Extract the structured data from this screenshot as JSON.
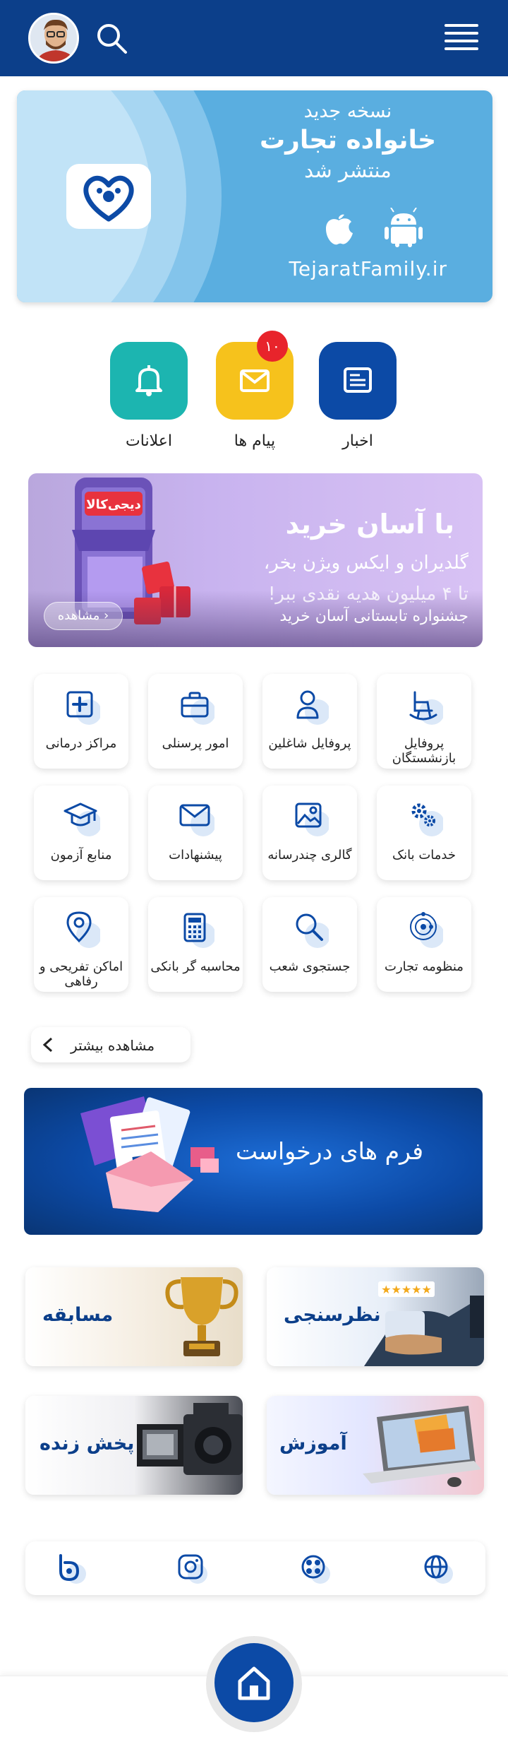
{
  "header": {
    "avatar_alt": "avatar",
    "search_icon": "search-icon",
    "menu_icon": "hamburger-menu-icon",
    "color": "#0c3f8a"
  },
  "promo": {
    "line1": "نسخه جدید",
    "line2": "خانواده تجارت",
    "line3": "منتشر شد",
    "url": "TejaratFamily.ir",
    "platforms": [
      "apple-icon",
      "android-icon"
    ],
    "color": "#5aaee0"
  },
  "quick_access": [
    {
      "label": "اخبار",
      "icon": "news-icon",
      "color": "#0c4aa6"
    },
    {
      "label": "پیام ها",
      "icon": "mail-icon",
      "color": "#f6c21c",
      "badge": "۱۰"
    },
    {
      "label": "اعلانات",
      "icon": "bell-icon",
      "color": "#1cb5b0"
    }
  ],
  "ad": {
    "title": "با آسان خرید",
    "subtitle1": "گلدیران و ایکس ویژن بخر،",
    "subtitle2": "تا ۴ میلیون هدیه نقدی ببر!",
    "caption": "جشنواره تابستانی آسان خرید",
    "more_label": "مشاهده",
    "store_label": "دیجی‌کالا"
  },
  "services": [
    {
      "label": "پروفایل بازنشستگان",
      "icon": "rocking-chair-icon"
    },
    {
      "label": "پروفایل شاغلین",
      "icon": "person-icon"
    },
    {
      "label": "امور پرسنلی",
      "icon": "briefcase-icon"
    },
    {
      "label": "مراکز درمانی",
      "icon": "medical-cross-icon"
    },
    {
      "label": "خدمات بانک",
      "icon": "gears-icon"
    },
    {
      "label": "گالری چندرسانه",
      "icon": "image-icon"
    },
    {
      "label": "پیشنهادات",
      "icon": "envelope-icon"
    },
    {
      "label": "منابع آزمون",
      "icon": "graduation-cap-icon"
    },
    {
      "label": "منظومه تجارت",
      "icon": "orbit-icon"
    },
    {
      "label": "جستجوی شعب",
      "icon": "search-icon"
    },
    {
      "label": "محاسبه گر بانکی",
      "icon": "calculator-icon"
    },
    {
      "label": "اماکن تفریحی و رفاهی",
      "icon": "location-pin-icon"
    }
  ],
  "more": {
    "label": "مشاهده بیشتر"
  },
  "form_banner": {
    "title": "فرم های درخواست"
  },
  "cards": [
    {
      "label": "نظرسنجی",
      "icon": "rating-stars-icon"
    },
    {
      "label": "مسابقه",
      "icon": "trophy-icon"
    },
    {
      "label": "آموزش",
      "icon": "laptop-books-icon"
    },
    {
      "label": "پخش زنده",
      "icon": "video-camera-icon"
    }
  ],
  "social": [
    "website-globe-icon",
    "aparat-icon",
    "instagram-icon",
    "bale-icon"
  ],
  "bottom_nav": {
    "home_icon": "home-icon"
  }
}
